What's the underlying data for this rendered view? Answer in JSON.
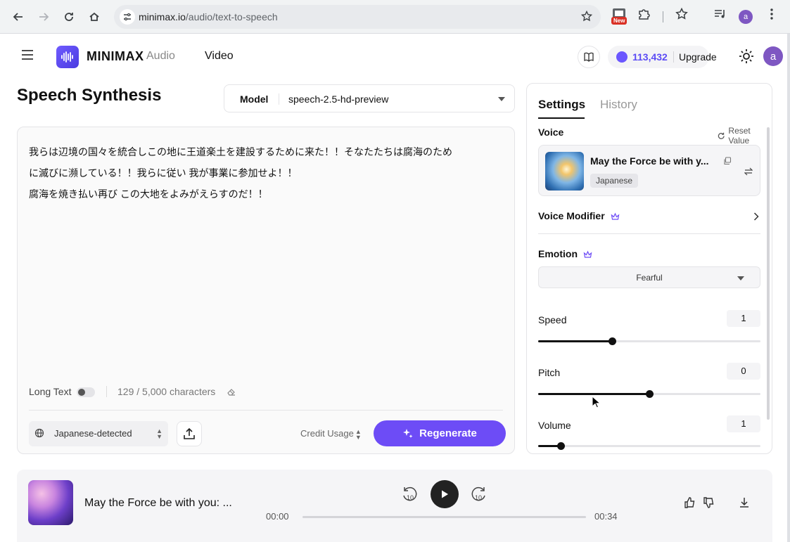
{
  "browser": {
    "url_host": "minimax.io",
    "url_path": "/audio/text-to-speech",
    "new_badge": "New",
    "profile_initial": "a"
  },
  "header": {
    "brand": "MINIMAX",
    "brand_sub": "Audio",
    "nav_video": "Video",
    "credits": "113,432",
    "upgrade": "Upgrade",
    "avatar_initial": "a"
  },
  "main": {
    "title": "Speech Synthesis",
    "model_label": "Model",
    "model_value": "speech-2.5-hd-preview",
    "text_lines": [
      "我らは辺境の国々を統合しこの地に王道楽土を建設するために来た！！そなたたちは腐海のため",
      "に滅びに瀕している！！我らに従い 我が事業に参加せよ！！",
      "腐海を焼き払い再び この大地をよみがえらすのだ！！"
    ],
    "long_text_label": "Long Text",
    "char_count": "129 / 5,000 characters",
    "language": "Japanese-detected",
    "credit_usage": "Credit Usage",
    "regenerate": "Regenerate"
  },
  "settings": {
    "tab_settings": "Settings",
    "tab_history": "History",
    "voice_label": "Voice",
    "reset_label": "Reset Value",
    "voice_name": "May the Force be with y...",
    "voice_tag": "Japanese",
    "voice_modifier_label": "Voice Modifier",
    "emotion_label": "Emotion",
    "emotion_value": "Fearful",
    "speed_label": "Speed",
    "speed_value": "1",
    "speed_fraction": 0.333,
    "pitch_label": "Pitch",
    "pitch_value": "0",
    "pitch_fraction": 0.5,
    "volume_label": "Volume",
    "volume_value": "1",
    "volume_fraction": 0.1
  },
  "player": {
    "title": "May the Force be with you: ...",
    "current_time": "00:00",
    "total_time": "00:34",
    "skip_back": "10",
    "skip_forward": "10"
  },
  "colors": {
    "accent": "#6d4cf6",
    "credit_text": "#5b4bf5"
  }
}
